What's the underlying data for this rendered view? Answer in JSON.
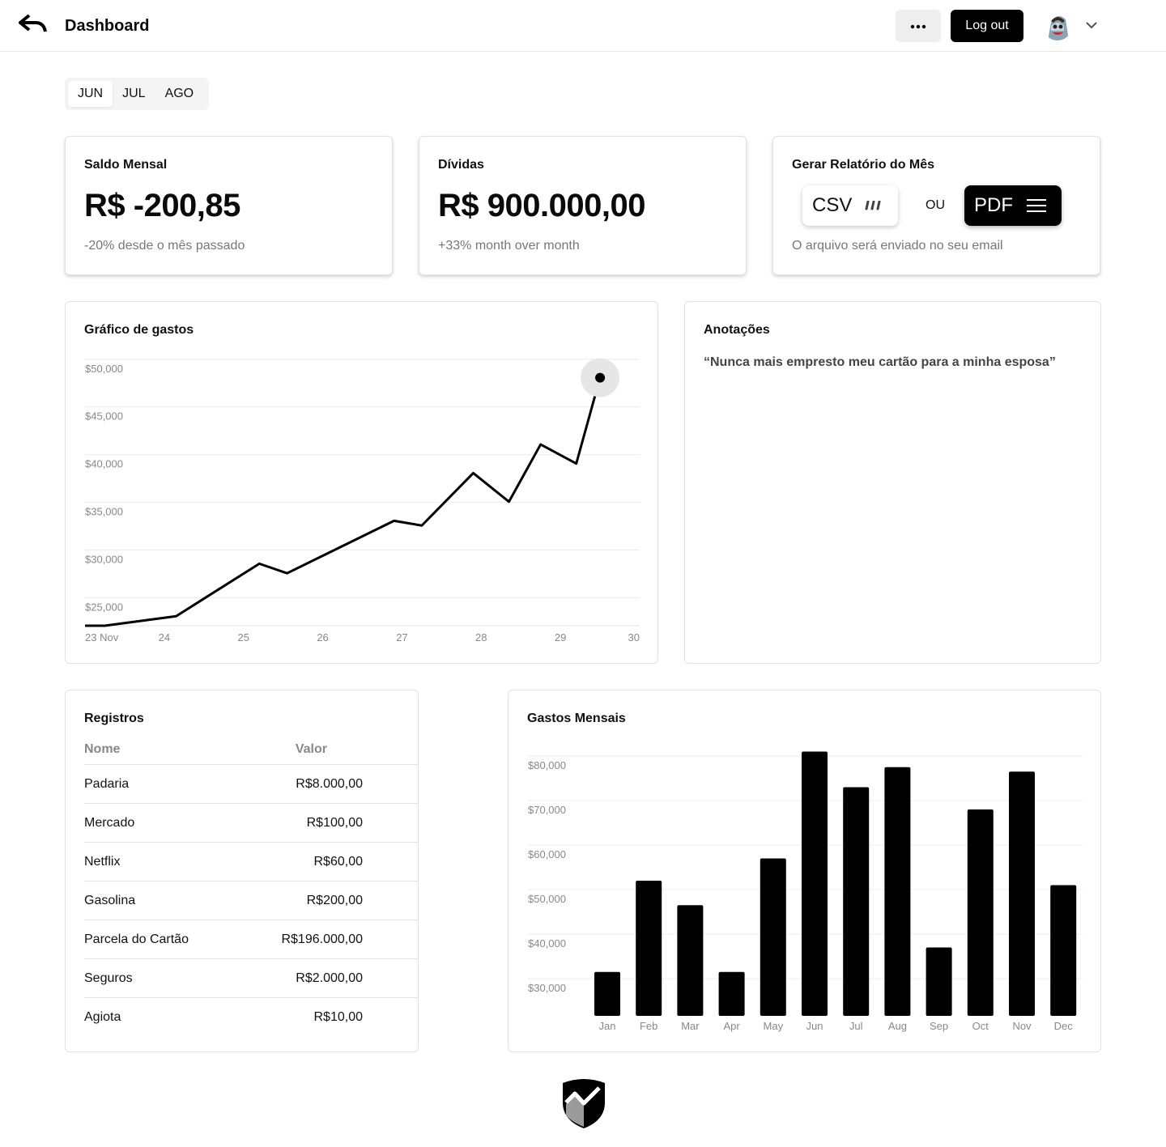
{
  "header": {
    "title": "Dashboard",
    "logout_label": "Log out",
    "icons": {
      "back": "back-arrow-icon",
      "more": "more-dots-icon",
      "chevron": "chevron-down-icon"
    }
  },
  "months": {
    "tabs": [
      "JUN",
      "JUL",
      "AGO"
    ],
    "active": "JUN"
  },
  "stats": {
    "saldo": {
      "title": "Saldo Mensal",
      "value": "R$ -200,85",
      "sub": "-20% desde o mês passado"
    },
    "dividas": {
      "title": "Dívidas",
      "value": "R$ 900.000,00",
      "sub": "+33% month over month"
    },
    "report": {
      "title": "Gerar Relatório do Mês",
      "csv_label": "CSV",
      "ou_label": "OU",
      "pdf_label": "PDF",
      "note": "O arquivo será enviado no seu email"
    }
  },
  "spending_chart": {
    "title": "Gráfico de gastos"
  },
  "notes": {
    "title": "Anotações",
    "text": "“Nunca mais empresto meu cartão para a minha esposa”"
  },
  "records": {
    "title": "Registros",
    "columns": [
      "Nome",
      "Valor"
    ],
    "rows": [
      {
        "name": "Padaria",
        "value": "R$8.000,00"
      },
      {
        "name": "Mercado",
        "value": "R$100,00"
      },
      {
        "name": "Netflix",
        "value": "R$60,00"
      },
      {
        "name": "Gasolina",
        "value": "R$200,00"
      },
      {
        "name": "Parcela do Cartão",
        "value": "R$196.000,00"
      },
      {
        "name": "Seguros",
        "value": "R$2.000,00"
      },
      {
        "name": "Agiota",
        "value": "R$10,00"
      }
    ]
  },
  "monthly_chart": {
    "title": "Gastos Mensais"
  },
  "chart_data": [
    {
      "type": "line",
      "title": "Gráfico de gastos",
      "x": [
        23.0,
        23.25,
        24.15,
        25.2,
        25.55,
        26.9,
        27.25,
        27.9,
        28.35,
        28.75,
        29.2,
        29.5
      ],
      "x_ticks": [
        "23 Nov",
        "24",
        "25",
        "26",
        "27",
        "28",
        "29",
        "30"
      ],
      "x_tick_values": [
        23,
        24,
        25,
        26,
        27,
        28,
        29,
        30
      ],
      "y": [
        23000,
        23000,
        24000,
        29500,
        28500,
        34000,
        33500,
        39000,
        36000,
        42000,
        40000,
        49000
      ],
      "y_ticks": [
        "$50,000",
        "$45,000",
        "$40,000",
        "$35,000",
        "$30,000",
        "$25,000"
      ],
      "y_tick_values": [
        50000,
        45000,
        40000,
        35000,
        30000,
        25000
      ],
      "xlim": [
        23,
        30
      ],
      "ylim": [
        23000,
        51000
      ],
      "grid": true,
      "highlight_last_point": true
    },
    {
      "type": "bar",
      "title": "Gastos Mensais",
      "categories": [
        "Jan",
        "Feb",
        "Mar",
        "Apr",
        "May",
        "Jun",
        "Jul",
        "Aug",
        "Sep",
        "Oct",
        "Nov",
        "Dec"
      ],
      "values": [
        31500,
        52000,
        46500,
        31500,
        57000,
        81000,
        73000,
        77500,
        37000,
        68000,
        76500,
        51000
      ],
      "y_ticks": [
        "$80,000",
        "$70,000",
        "$60,000",
        "$50,000",
        "$40,000",
        "$30,000"
      ],
      "y_tick_values": [
        80000,
        70000,
        60000,
        50000,
        40000,
        30000
      ],
      "ylim": [
        22000,
        82000
      ],
      "grid": true
    }
  ]
}
